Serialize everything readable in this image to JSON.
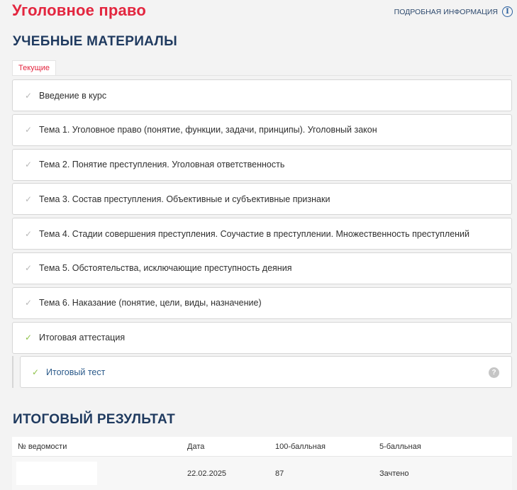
{
  "header": {
    "course_title": "Уголовное право",
    "info_link": "ПОДРОБНАЯ ИНФОРМАЦИЯ",
    "info_icon": "i"
  },
  "materials": {
    "heading": "УЧЕБНЫЕ МАТЕРИАЛЫ",
    "tab_current": "Текущие",
    "items": [
      {
        "label": "Введение в курс",
        "check": "✓",
        "done": false
      },
      {
        "label": "Тема 1. Уголовное право (понятие, функции, задачи, принципы). Уголовный закон",
        "check": "✓",
        "done": false
      },
      {
        "label": "Тема 2. Понятие преступления. Уголовная ответственность",
        "check": "✓",
        "done": false
      },
      {
        "label": "Тема 3. Состав преступления. Объективные и субъективные признаки",
        "check": "✓",
        "done": false
      },
      {
        "label": "Тема 4. Стадии совершения преступления. Соучастие в преступлении. Множественность преступлений",
        "check": "✓",
        "done": false
      },
      {
        "label": "Тема 5. Обстоятельства, исключающие преступность деяния",
        "check": "✓",
        "done": false
      },
      {
        "label": "Тема 6. Наказание (понятие, цели, виды, назначение)",
        "check": "✓",
        "done": false
      },
      {
        "label": "Итоговая аттестация",
        "check": "✓",
        "done": true
      }
    ],
    "sub_item": {
      "label": "Итоговый тест",
      "check": "✓",
      "help": "?"
    }
  },
  "results": {
    "heading": "ИТОГОВЫЙ РЕЗУЛЬТАТ",
    "columns": [
      "№ ведомости",
      "Дата",
      "100-балльная",
      "5-балльная"
    ],
    "row": {
      "statement": "",
      "date": "22.02.2025",
      "score100": "87",
      "score5": "Зачтено"
    }
  },
  "colors": {
    "accent": "#e3263f",
    "heading": "#1f3a5f",
    "check_done": "#8fc24a",
    "check_pending": "#b9b9b9"
  }
}
